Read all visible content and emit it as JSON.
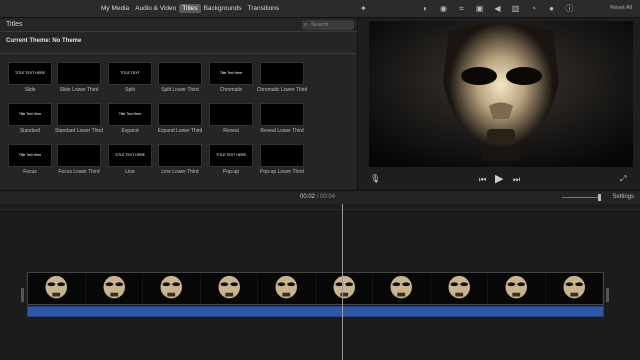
{
  "top_tabs": [
    "My Media",
    "Audio & Video",
    "Titles",
    "Backgrounds",
    "Transitions"
  ],
  "active_tab": "Titles",
  "viewer_toolbar": {
    "icons": [
      "color-balance-icon",
      "color-correction-icon",
      "crop-icon",
      "stabilization-icon",
      "volume-icon",
      "noise-reduction-icon",
      "speed-icon",
      "clip-filter-icon",
      "info-icon"
    ],
    "reset_all_label": "Reset All"
  },
  "browser": {
    "title": "Titles",
    "search_placeholder": "Search",
    "current_theme": "Current Theme: No Theme",
    "titles": [
      {
        "label": "Slide",
        "preview": "TITLE TEXT HERE"
      },
      {
        "label": "Slide Lower Third",
        "preview": ""
      },
      {
        "label": "Split",
        "preview": "TITLE TEXT"
      },
      {
        "label": "Split Lower Third",
        "preview": ""
      },
      {
        "label": "Chromatic",
        "preview": "Title Text Here"
      },
      {
        "label": "Chromatic Lower Third",
        "preview": ""
      },
      {
        "label": "Standard",
        "preview": "Title Text Here"
      },
      {
        "label": "Standard Lower Third",
        "preview": ""
      },
      {
        "label": "Expand",
        "preview": "Title Text Here"
      },
      {
        "label": "Expand Lower Third",
        "preview": ""
      },
      {
        "label": "Reveal",
        "preview": ""
      },
      {
        "label": "Reveal Lower Third",
        "preview": ""
      },
      {
        "label": "Focus",
        "preview": "Title Text Here"
      },
      {
        "label": "Focus Lower Third",
        "preview": ""
      },
      {
        "label": "Line",
        "preview": "TITLE TEXT HERE"
      },
      {
        "label": "Line Lower Third",
        "preview": ""
      },
      {
        "label": "Pop-up",
        "preview": "TITLE TEXT HERE"
      },
      {
        "label": "Pop-up Lower Third",
        "preview": ""
      }
    ]
  },
  "timeline": {
    "current_time": "00:02",
    "separator": "/",
    "total_time": "00:04",
    "settings_label": "Settings",
    "frame_count": 10
  }
}
